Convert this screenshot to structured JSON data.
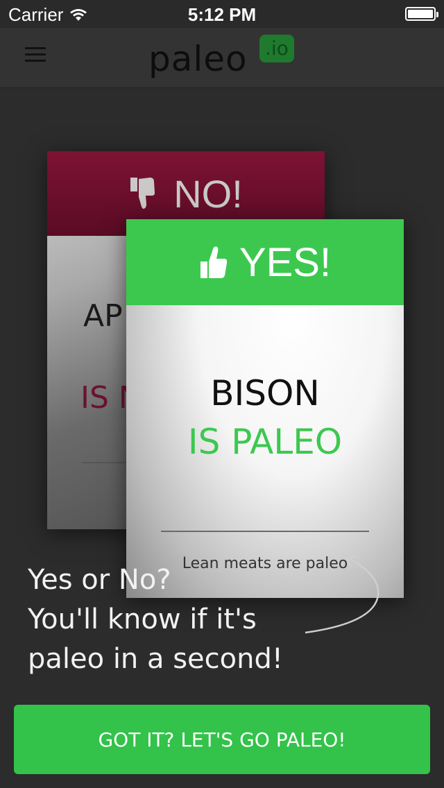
{
  "status_bar": {
    "carrier": "Carrier",
    "time": "5:12 PM"
  },
  "nav": {
    "logo_text": "paleo",
    "logo_badge": ".io"
  },
  "cards": {
    "back": {
      "header_label": "NO!",
      "food": "AP",
      "verdict": "IS N",
      "header_color": "#7d1234"
    },
    "front": {
      "header_label": "YES!",
      "food": "BISON",
      "verdict": "IS PALEO",
      "note": "Lean meats are paleo",
      "header_color": "#3cc84f"
    }
  },
  "tagline": {
    "line1": "Yes or No?",
    "line2": "You'll know if it's",
    "line3": "paleo in a second!"
  },
  "cta": {
    "label": "GOT IT? LET'S GO PALEO!",
    "color": "#33c24a"
  },
  "icons": {
    "menu": "hamburger-icon",
    "thumbs_down": "thumbs-down-icon",
    "thumbs_up": "thumbs-up-icon",
    "wifi": "wifi-icon",
    "battery": "battery-icon"
  }
}
